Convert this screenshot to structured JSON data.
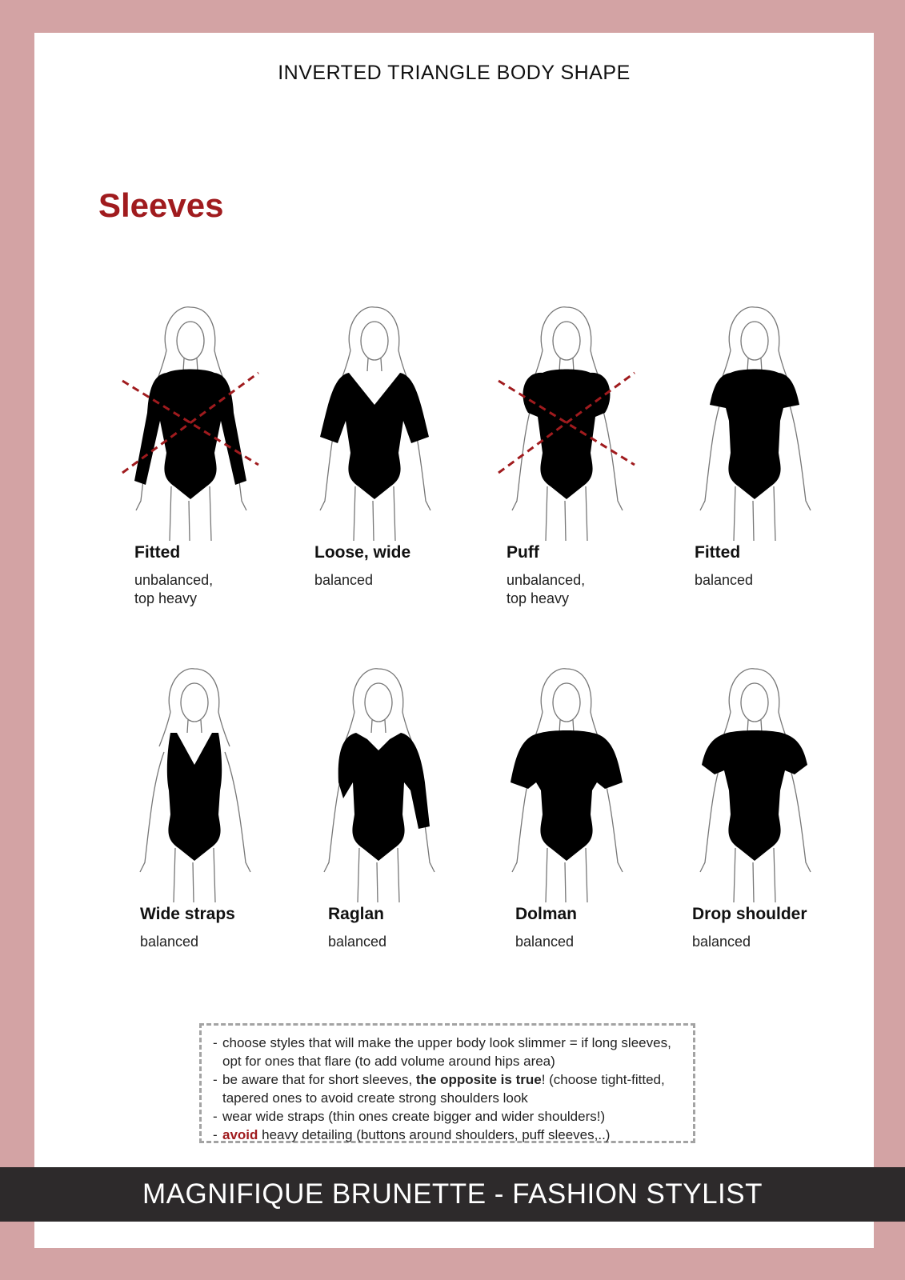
{
  "header": {
    "title": "INVERTED TRIANGLE BODY SHAPE"
  },
  "section": {
    "heading": "Sleeves"
  },
  "figures": [
    {
      "label": "Fitted",
      "verdict": "unbalanced,\ntop heavy",
      "crossed": true,
      "style": "long-fitted"
    },
    {
      "label": "Loose, wide",
      "verdict": "balanced",
      "crossed": false,
      "style": "loose-wide"
    },
    {
      "label": "Puff",
      "verdict": "unbalanced,\ntop heavy",
      "crossed": true,
      "style": "puff"
    },
    {
      "label": "Fitted",
      "verdict": "balanced",
      "crossed": false,
      "style": "short-fitted"
    },
    {
      "label": "Wide straps",
      "verdict": "balanced",
      "crossed": false,
      "style": "wide-straps"
    },
    {
      "label": "Raglan",
      "verdict": "balanced",
      "crossed": false,
      "style": "raglan"
    },
    {
      "label": "Dolman",
      "verdict": "balanced",
      "crossed": false,
      "style": "dolman"
    },
    {
      "label": "Drop shoulder",
      "verdict": "balanced",
      "crossed": false,
      "style": "drop-shoulder"
    }
  ],
  "tips": {
    "t1": "choose styles that will make the upper body look slimmer = if long sleeves, opt for ones that flare (to add volume around hips area)",
    "t2a": "be aware that for short sleeves, ",
    "t2b": "the opposite is true",
    "t2c": "! (choose tight-fitted, tapered ones to avoid create strong shoulders look",
    "t3": "wear wide straps (thin ones create bigger and wider shoulders!)",
    "t4a": "avoid",
    "t4b": " heavy detailing (buttons around shoulders, puff sleeves,..)"
  },
  "footer": {
    "text": "MAGNIFIQUE BRUNETTE - FASHION STYLIST"
  },
  "colors": {
    "frame": "#d3a3a4",
    "accent": "#a01b1e",
    "footer_bg": "#2d2a2b"
  }
}
